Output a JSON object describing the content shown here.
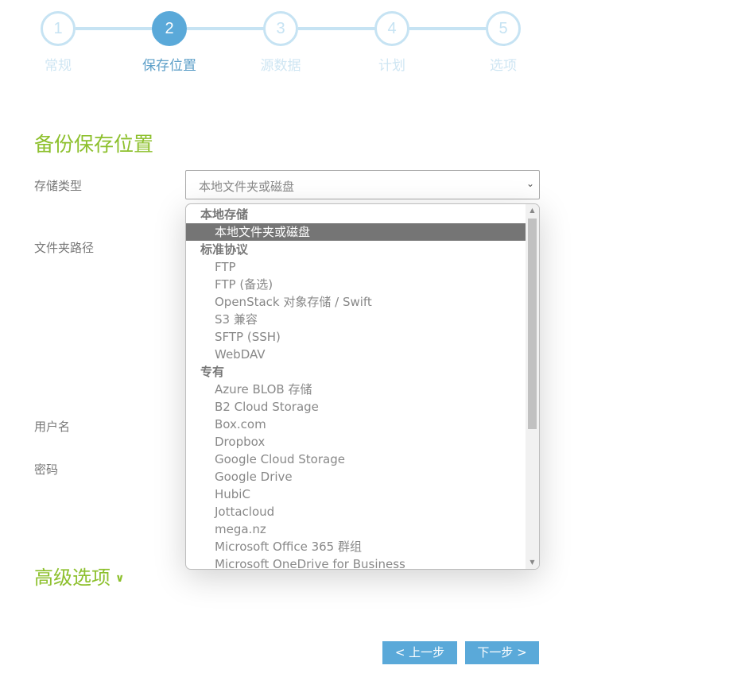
{
  "stepper": {
    "steps": [
      {
        "number": "1",
        "label": "常规",
        "state": "inactive"
      },
      {
        "number": "2",
        "label": "保存位置",
        "state": "active"
      },
      {
        "number": "3",
        "label": "源数据",
        "state": "inactive"
      },
      {
        "number": "4",
        "label": "计划",
        "state": "inactive"
      },
      {
        "number": "5",
        "label": "选项",
        "state": "inactive"
      }
    ]
  },
  "section_title": "备份保存位置",
  "form": {
    "storage_type_label": "存储类型",
    "storage_type_value": "本地文件夹或磁盘",
    "folder_path_label": "文件夹路径",
    "username_label": "用户名",
    "password_label": "密码"
  },
  "dropdown": {
    "groups": [
      {
        "label": "本地存储",
        "options": [
          {
            "label": "本地文件夹或磁盘",
            "selected": true
          }
        ]
      },
      {
        "label": "标准协议",
        "options": [
          {
            "label": "FTP"
          },
          {
            "label": "FTP (备选)"
          },
          {
            "label": "OpenStack 对象存储 / Swift"
          },
          {
            "label": "S3 兼容"
          },
          {
            "label": "SFTP (SSH)"
          },
          {
            "label": "WebDAV"
          }
        ]
      },
      {
        "label": "专有",
        "options": [
          {
            "label": "Azure BLOB 存储"
          },
          {
            "label": "B2 Cloud Storage"
          },
          {
            "label": "Box.com"
          },
          {
            "label": "Dropbox"
          },
          {
            "label": "Google Cloud Storage"
          },
          {
            "label": "Google Drive"
          },
          {
            "label": "HubiC"
          },
          {
            "label": "Jottacloud"
          },
          {
            "label": "mega.nz"
          },
          {
            "label": "Microsoft Office 365 群组"
          },
          {
            "label": "Microsoft OneDrive for Business"
          }
        ]
      }
    ],
    "scroll_up_icon": "▲",
    "scroll_down_icon": "▼"
  },
  "advanced": {
    "label": "高级选项",
    "icon": "chevron-down"
  },
  "buttons": {
    "prev": "< 上一步",
    "next": "下一步 >"
  },
  "colors": {
    "accent_blue": "#5aa9d9",
    "step_inactive": "#c6e3f3",
    "heading_green": "#8dc02d",
    "selected_option_bg": "#757575"
  }
}
